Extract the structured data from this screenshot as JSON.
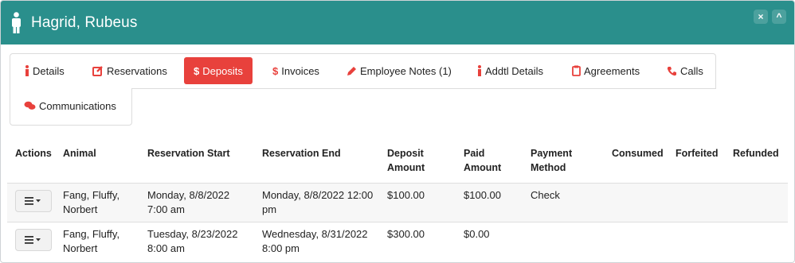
{
  "header": {
    "title": "Hagrid, Rubeus",
    "icon": "person-icon",
    "close_glyph": "×",
    "collapse_glyph": "^"
  },
  "tabs": [
    {
      "label": "Details",
      "icon": "info-icon"
    },
    {
      "label": "Reservations",
      "icon": "edit-icon"
    },
    {
      "label": "Deposits",
      "icon": "dollar-icon",
      "prefix": "$",
      "active": true
    },
    {
      "label": "Invoices",
      "icon": "dollar-icon",
      "prefix": "$"
    },
    {
      "label": "Employee Notes (1)",
      "icon": "pencil-icon"
    },
    {
      "label": "Addtl Details",
      "icon": "info-icon"
    },
    {
      "label": "Agreements",
      "icon": "clipboard-icon"
    },
    {
      "label": "Calls",
      "icon": "phone-icon"
    },
    {
      "label": "Communications",
      "icon": "chat-icon"
    }
  ],
  "colors": {
    "header_bg": "#2a8f8c",
    "active_tab": "#e8413c",
    "icon_red": "#e8413c"
  },
  "table": {
    "columns": [
      [
        "Actions"
      ],
      [
        "Animal"
      ],
      [
        "Reservation Start"
      ],
      [
        "Reservation End"
      ],
      [
        "Deposit",
        "Amount"
      ],
      [
        "Paid",
        "Amount"
      ],
      [
        "Payment",
        "Method"
      ],
      [
        "Consumed"
      ],
      [
        "Forfeited"
      ],
      [
        "Refunded"
      ]
    ],
    "rows": [
      {
        "animal": [
          "Fang, Fluffy,",
          "Norbert"
        ],
        "start": [
          "Monday, 8/8/2022",
          "7:00 am"
        ],
        "end": [
          "Monday, 8/8/2022 12:00",
          "pm"
        ],
        "deposit": "$100.00",
        "paid": "$100.00",
        "method": "Check",
        "consumed": "",
        "forfeited": "",
        "refunded": ""
      },
      {
        "animal": [
          "Fang, Fluffy,",
          "Norbert"
        ],
        "start": [
          "Tuesday, 8/23/2022",
          "8:00 am"
        ],
        "end": [
          "Wednesday, 8/31/2022",
          "8:00 pm"
        ],
        "deposit": "$300.00",
        "paid": "$0.00",
        "method": "",
        "consumed": "",
        "forfeited": "",
        "refunded": ""
      }
    ]
  }
}
